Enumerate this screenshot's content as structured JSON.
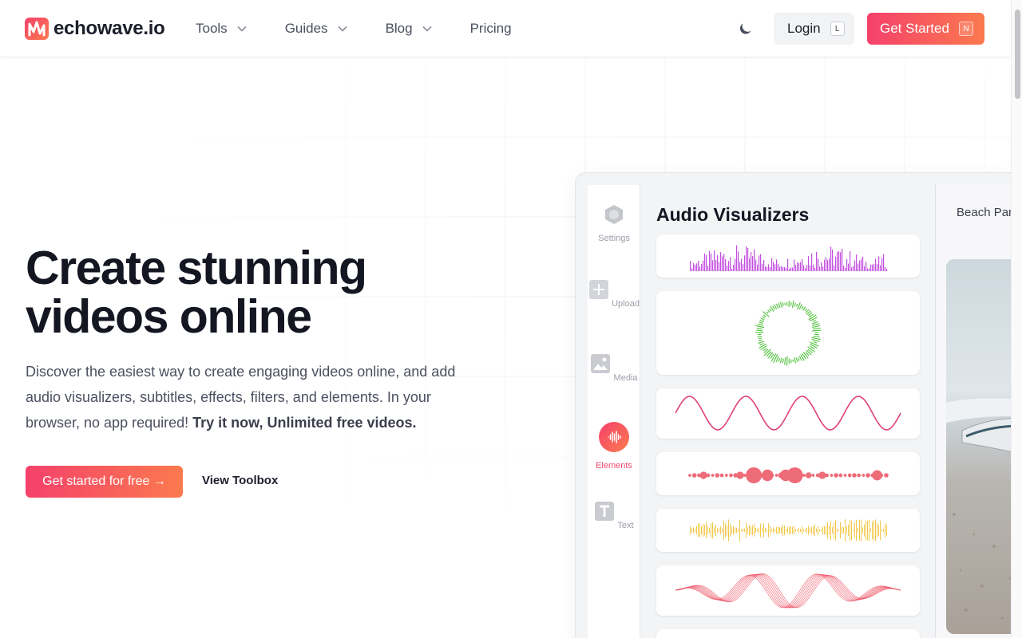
{
  "brand": {
    "name": "echowave.io",
    "accent": "#f5416b",
    "accent_end": "#fb7a4e"
  },
  "nav": {
    "items": [
      {
        "label": "Tools",
        "has_dropdown": true
      },
      {
        "label": "Guides",
        "has_dropdown": true
      },
      {
        "label": "Blog",
        "has_dropdown": true
      },
      {
        "label": "Pricing",
        "has_dropdown": false
      }
    ],
    "theme_icon": "moon-icon",
    "login": {
      "label": "Login",
      "shortcut": "L"
    },
    "get_started": {
      "label": "Get Started",
      "shortcut": "N"
    }
  },
  "hero": {
    "title_line1": "Create stunning",
    "title_line2": "videos online",
    "description": "Discover the easiest way to create engaging videos online, and add audio visualizers, subtitles, effects, filters, and elements. In your browser, no app required!",
    "description_bold": "Try it now, Unlimited free videos.",
    "cta_primary": "Get started for free →",
    "cta_secondary": "View Toolbox"
  },
  "editor": {
    "sidebar": [
      {
        "label": "Settings",
        "icon": "hexagon-icon",
        "active": false
      },
      {
        "label": "Upload",
        "icon": "plus-icon",
        "active": false
      },
      {
        "label": "Media",
        "icon": "image-icon",
        "active": false
      },
      {
        "label": "Elements",
        "icon": "waveform-icon",
        "active": true
      },
      {
        "label": "Text",
        "icon": "text-icon",
        "active": false
      }
    ],
    "panel_title": "Audio Visualizers",
    "visualizers": [
      {
        "name": "bars-purple",
        "color": "#c44fe0"
      },
      {
        "name": "circle-green",
        "color": "#5cc449"
      },
      {
        "name": "sine-pink",
        "color": "#e0407a"
      },
      {
        "name": "dots-red",
        "color": "#ee6b78"
      },
      {
        "name": "waveform-yellow",
        "color": "#f2c84a"
      },
      {
        "name": "helix-red",
        "color": "#ee5d6e"
      }
    ],
    "preview_title": "Beach Par"
  }
}
